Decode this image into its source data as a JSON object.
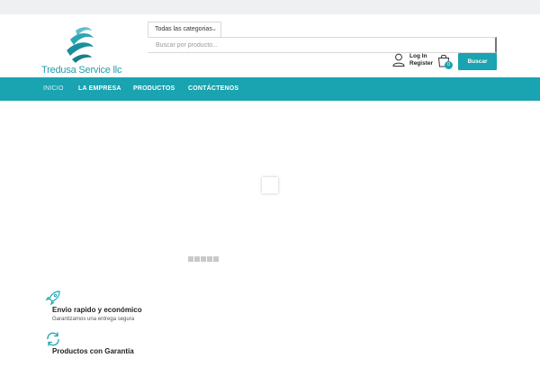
{
  "logo": {
    "text": "Tredusa Service llc"
  },
  "search": {
    "category_label": "Todas las categorias",
    "placeholder": "Buscar por producto...",
    "button_label": "Buscar"
  },
  "account": {
    "login_label": "Log In",
    "register_label": "Register"
  },
  "cart": {
    "count": "0"
  },
  "nav": {
    "items": [
      {
        "label": "INICIO"
      },
      {
        "label": "LA EMPRESA"
      },
      {
        "label": "PRODUCTOS"
      },
      {
        "label": "CONTÁCTENOS"
      }
    ]
  },
  "features": [
    {
      "title": "Envio rapido y económico",
      "description": "Garantizamos una entrega segura",
      "icon": "rocket-icon"
    },
    {
      "title": "Productos con Garantía",
      "description": "",
      "icon": "refresh-icon"
    }
  ],
  "colors": {
    "accent": "#1aa3b0",
    "top_strip": "#eef0f1"
  }
}
